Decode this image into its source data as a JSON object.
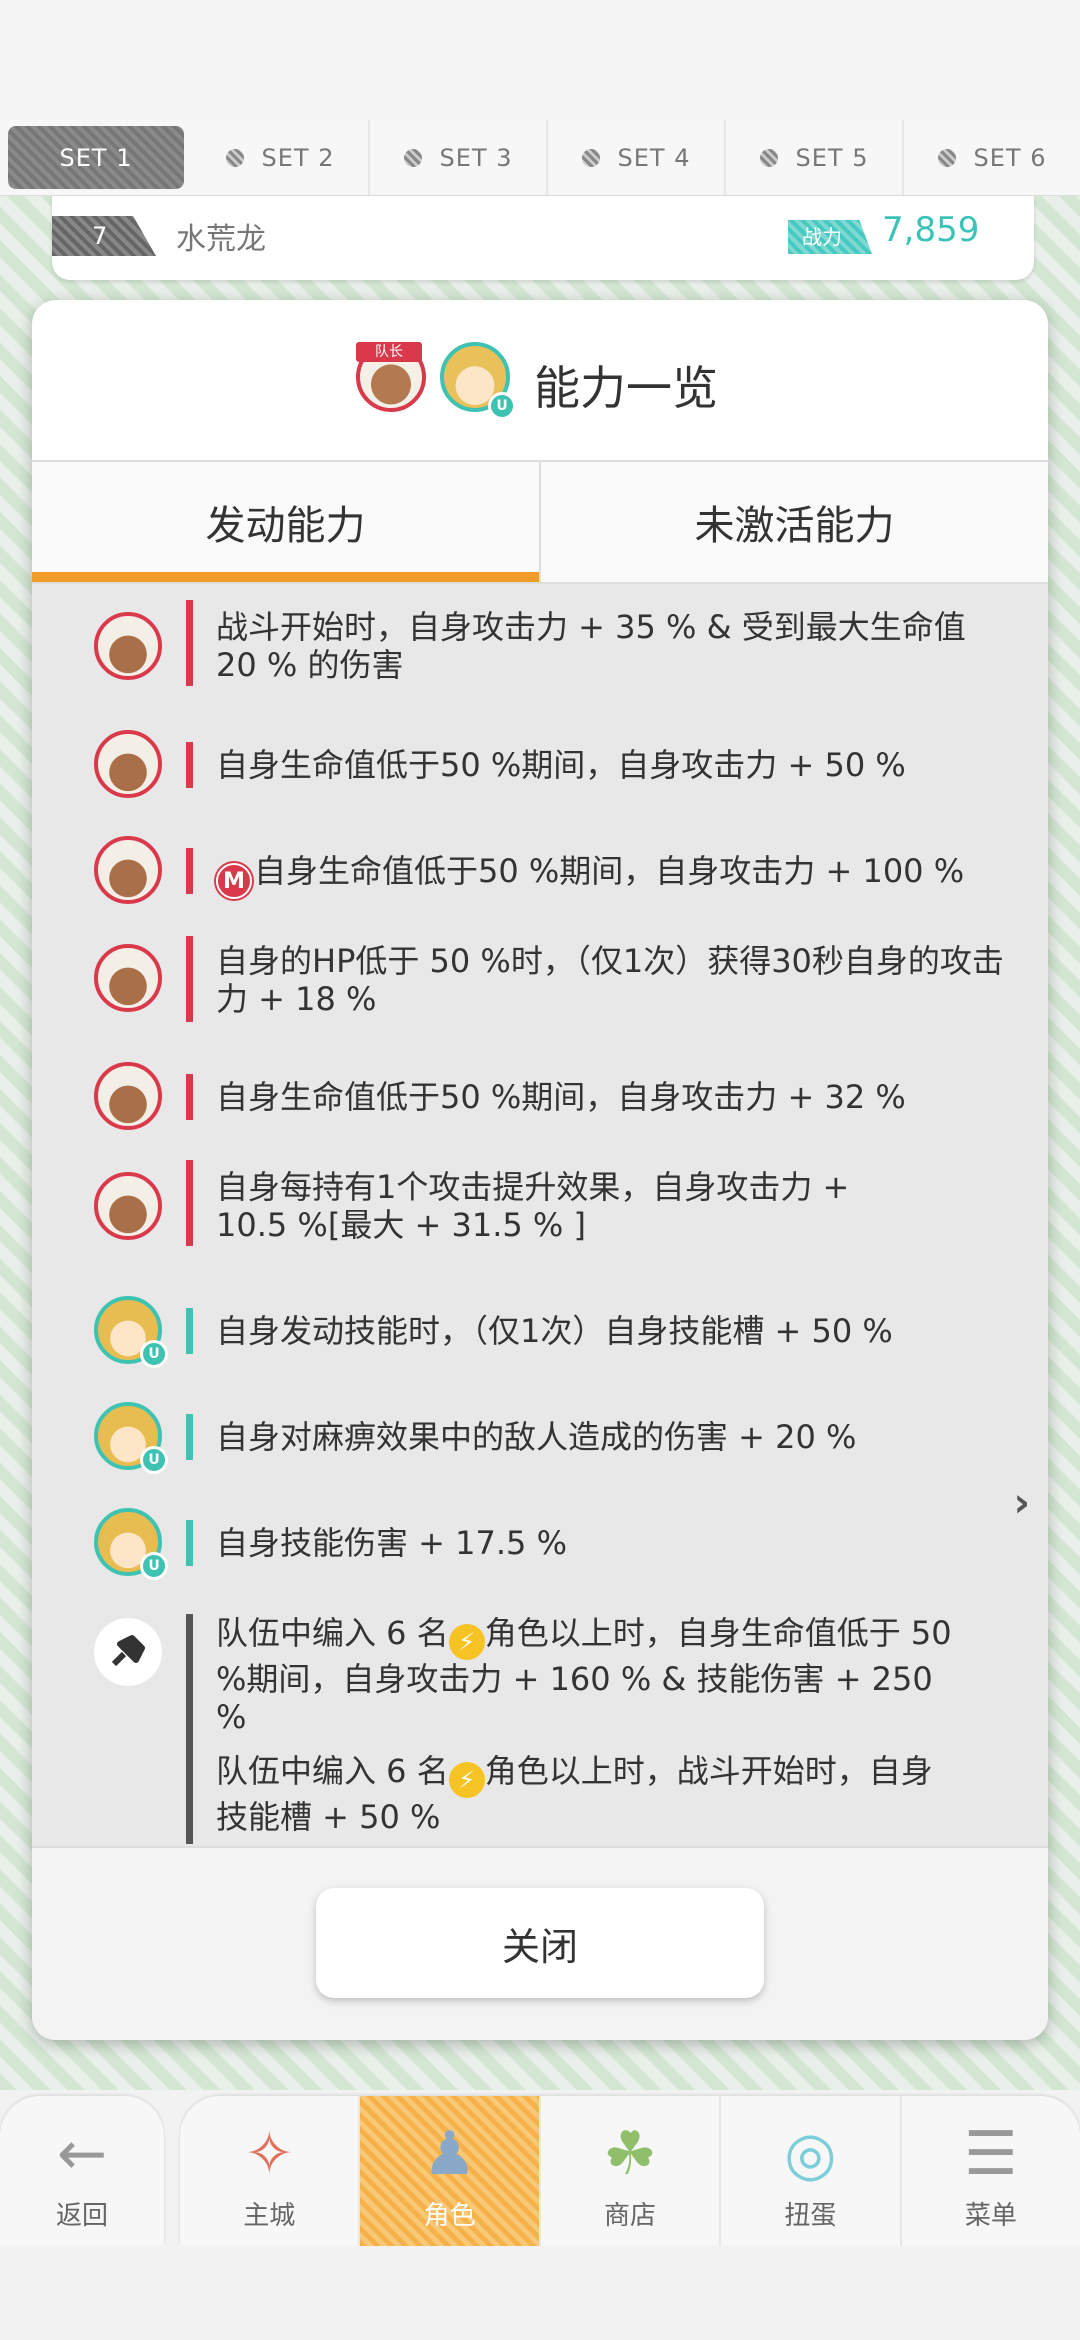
{
  "set_tabs": [
    {
      "label": "SET 1",
      "active": true
    },
    {
      "label": "SET 2",
      "active": false
    },
    {
      "label": "SET 3",
      "active": false
    },
    {
      "label": "SET 4",
      "active": false
    },
    {
      "label": "SET 5",
      "active": false
    },
    {
      "label": "SET 6",
      "active": false
    }
  ],
  "team": {
    "number": "7",
    "name": "水荒龙",
    "power_label": "战力",
    "power_value": "7,859"
  },
  "modal": {
    "leader_tag": "队长",
    "u_badge": "U",
    "title": "能力一览",
    "tabs": [
      {
        "label": "发动能力",
        "active": true
      },
      {
        "label": "未激活能力",
        "active": false
      }
    ],
    "abilities": [
      {
        "owner": "leader",
        "lines": [
          "战斗开始时，自身攻击力 + 35 % & 受到最大生命值 20 % 的伤害"
        ]
      },
      {
        "owner": "leader",
        "lines": [
          "自身生命值低于50 %期间，自身攻击力 + 50 %"
        ]
      },
      {
        "owner": "leader",
        "m_badge": "M",
        "lines": [
          "自身生命值低于50 %期间，自身攻击力 + 100 %"
        ]
      },
      {
        "owner": "leader",
        "lines": [
          "自身的HP低于 50 %时，（仅1次）获得30秒自身的攻击力 + 18 %"
        ]
      },
      {
        "owner": "leader",
        "lines": [
          "自身生命值低于50 %期间，自身攻击力 + 32 %"
        ]
      },
      {
        "owner": "leader",
        "lines": [
          "自身每持有1个攻击提升效果，自身攻击力 + 10.5 %[最大 + 31.5 % ]"
        ]
      },
      {
        "owner": "sub",
        "lines": [
          "自身发动技能时，（仅1次）自身技能槽 + 50 %"
        ]
      },
      {
        "owner": "sub",
        "lines": [
          "自身对麻痹效果中的敌人造成的伤害 + 20 %"
        ]
      },
      {
        "owner": "sub",
        "lines": [
          "自身技能伤害 + 17.5 %"
        ]
      },
      {
        "owner": "item",
        "segments": [
          {
            "pre": "队伍中编入 6 名",
            "post": "角色以上时，自身生命值低于 50 %期间，自身攻击力 + 160 % & 技能伤害 + 250 %"
          },
          {
            "pre": "队伍中编入 6 名",
            "post": "角色以上时，战斗开始时，自身技能槽 + 50 %"
          }
        ]
      }
    ],
    "close_label": "关闭"
  },
  "nav": {
    "back": {
      "label": "返回",
      "icon": "back-arrow-icon"
    },
    "items": [
      {
        "label": "主城",
        "icon": "home-icon",
        "active": false
      },
      {
        "label": "角色",
        "icon": "character-icon",
        "active": true
      },
      {
        "label": "商店",
        "icon": "shop-icon",
        "active": false
      },
      {
        "label": "扭蛋",
        "icon": "gacha-icon",
        "active": false
      },
      {
        "label": "菜单",
        "icon": "menu-icon",
        "active": false
      }
    ]
  },
  "colors": {
    "accent_orange": "#f39b28",
    "leader_red": "#d9394a",
    "sub_teal": "#3ec2b2",
    "power_teal": "#3cc3b8"
  }
}
